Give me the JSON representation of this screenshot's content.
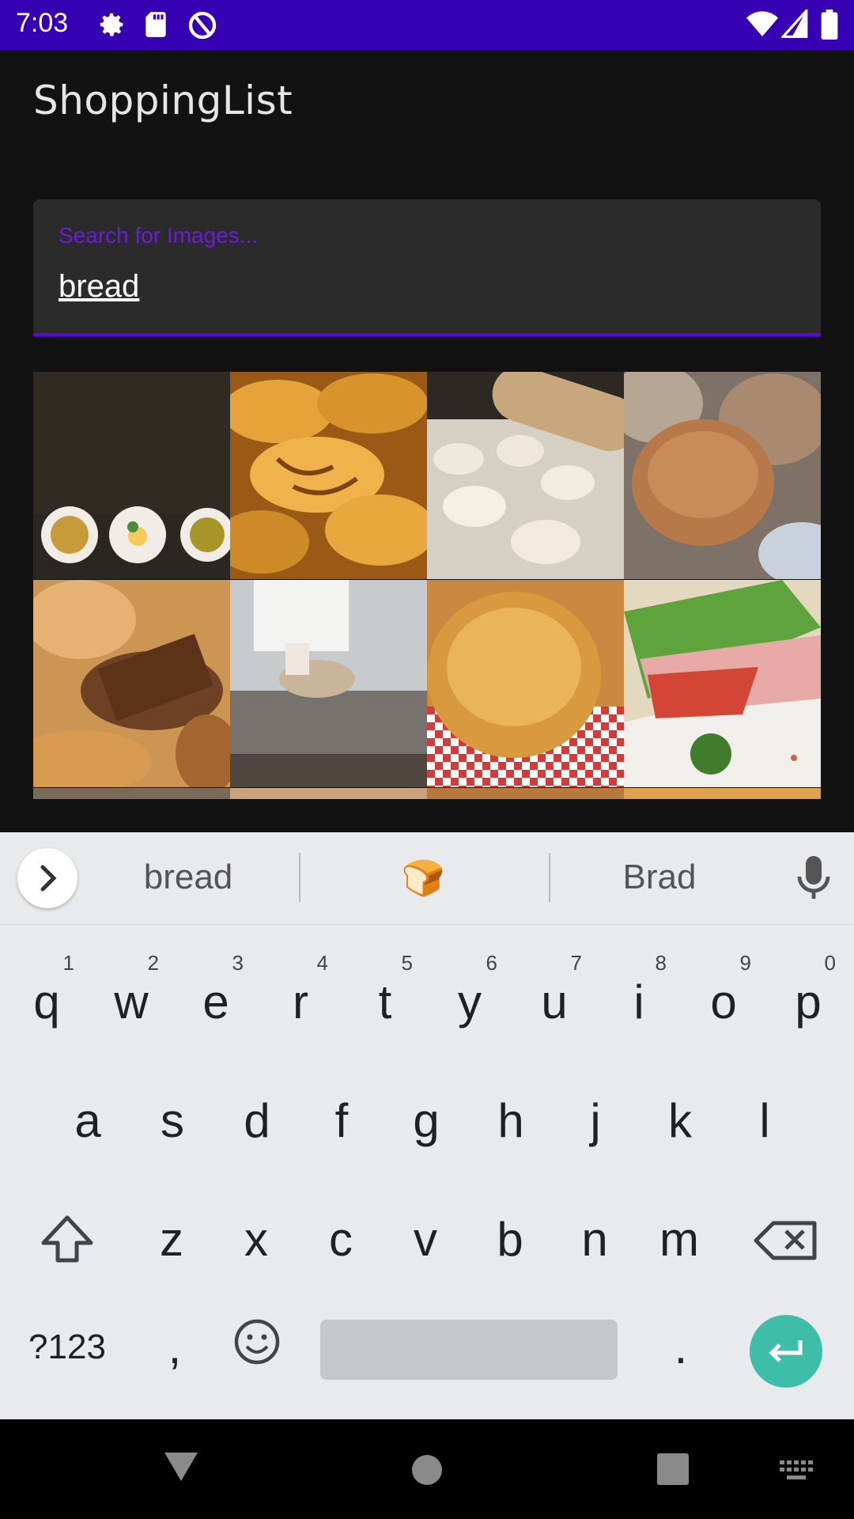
{
  "status_bar": {
    "time": "7:03",
    "icons": [
      "settings-icon",
      "sd-card-icon",
      "data-saver-icon",
      "wifi-icon",
      "signal-icon",
      "battery-icon"
    ]
  },
  "app": {
    "title": "ShoppingList"
  },
  "search": {
    "label": "Search for Images...",
    "value": "bread"
  },
  "image_grid": {
    "tiles": [
      {
        "name": "bowls-on-dark-image"
      },
      {
        "name": "croissants-image"
      },
      {
        "name": "dough-balls-image"
      },
      {
        "name": "rustic-bread-loaves-image"
      },
      {
        "name": "bread-assortment-image"
      },
      {
        "name": "kneading-dough-image"
      },
      {
        "name": "round-bread-checkered-image"
      },
      {
        "name": "ham-sandwich-image"
      }
    ]
  },
  "keyboard": {
    "suggestions": [
      "bread",
      "🍞",
      "Brad"
    ],
    "row1": [
      {
        "letter": "q",
        "hint": "1"
      },
      {
        "letter": "w",
        "hint": "2"
      },
      {
        "letter": "e",
        "hint": "3"
      },
      {
        "letter": "r",
        "hint": "4"
      },
      {
        "letter": "t",
        "hint": "5"
      },
      {
        "letter": "y",
        "hint": "6"
      },
      {
        "letter": "u",
        "hint": "7"
      },
      {
        "letter": "i",
        "hint": "8"
      },
      {
        "letter": "o",
        "hint": "9"
      },
      {
        "letter": "p",
        "hint": "0"
      }
    ],
    "row2": [
      "a",
      "s",
      "d",
      "f",
      "g",
      "h",
      "j",
      "k",
      "l"
    ],
    "row3": [
      "z",
      "x",
      "c",
      "v",
      "b",
      "n",
      "m"
    ],
    "symbols_label": "?123",
    "comma_label": ",",
    "period_label": "."
  },
  "colors": {
    "status_bar": "#3700b3",
    "accent": "#6200ee",
    "background": "#121212",
    "enter_key": "#3ebea8"
  }
}
